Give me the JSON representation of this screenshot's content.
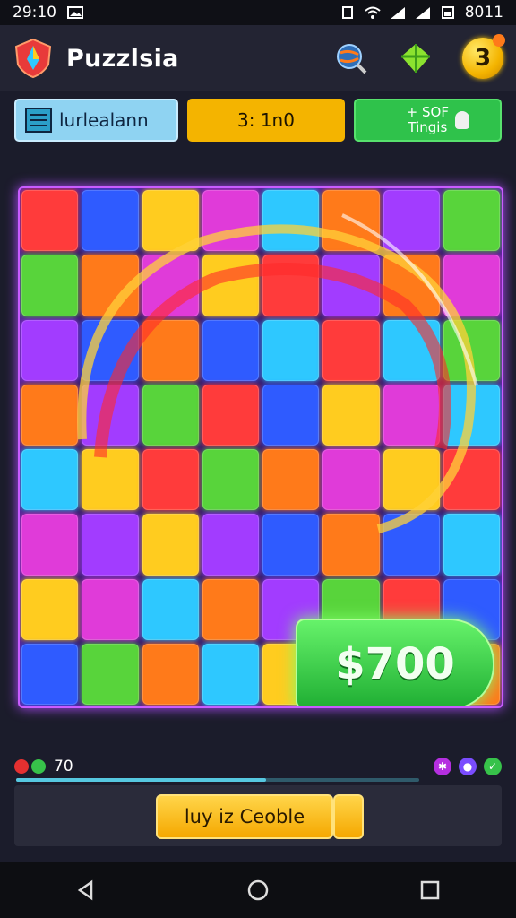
{
  "status_bar": {
    "time": "29:10",
    "battery": "8011",
    "icons": [
      "image-icon",
      "sim-icon",
      "wifi-icon",
      "signal-icon",
      "signal-icon",
      "battery-icon"
    ]
  },
  "header": {
    "title": "Puzzlsia",
    "coin_count": "3",
    "icons": [
      "logo-icon",
      "globe-search-icon",
      "green-gem-icon",
      "coin-icon"
    ]
  },
  "info": {
    "player_name": "lurlealann",
    "score": "3: 1n0",
    "bonus_line1": "+ SOF",
    "bonus_line2": "Tingis"
  },
  "board": {
    "prize_label": "$700",
    "columns": 8,
    "rows": 8
  },
  "progress": {
    "value_text": "70",
    "fill_fraction": 0.62,
    "dot_colors": [
      "#e53030",
      "#37c24a"
    ],
    "right_icons": [
      "purple-star-icon",
      "violet-drop-icon",
      "green-check-icon"
    ]
  },
  "action": {
    "button_label": "luy iz Ceoble"
  },
  "nav": {
    "back": "back-icon",
    "home": "home-icon",
    "recents": "recents-icon"
  },
  "colors": {
    "accent_purple": "#c95cff",
    "accent_green": "#2fc24b",
    "accent_gold": "#f4b400",
    "tile_palette": [
      "#ff3b3b",
      "#ff7a1a",
      "#ffcc1f",
      "#58d43b",
      "#2ec8ff",
      "#2f5bff",
      "#a23cff",
      "#e03bd9"
    ]
  }
}
